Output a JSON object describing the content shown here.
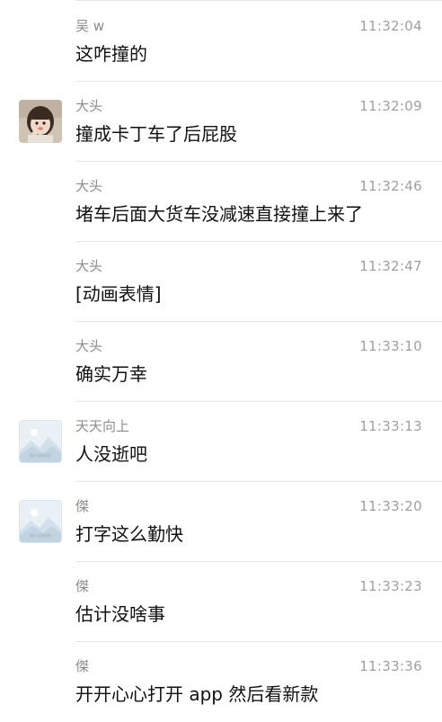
{
  "messages": [
    {
      "sender": "吴 w",
      "time": "11:32:04",
      "text": "这咋撞的",
      "avatar": "none"
    },
    {
      "sender": "大头",
      "time": "11:32:09",
      "text": "撞成卡丁车了后屁股",
      "avatar": "photo"
    },
    {
      "sender": "大头",
      "time": "11:32:46",
      "text": "堵车后面大货车没减速直接撞上来了",
      "avatar": "none"
    },
    {
      "sender": "大头",
      "time": "11:32:47",
      "text": "[动画表情]",
      "avatar": "none"
    },
    {
      "sender": "大头",
      "time": "11:33:10",
      "text": "确实万幸",
      "avatar": "none"
    },
    {
      "sender": "天天向上",
      "time": "11:33:13",
      "text": "人没逝吧",
      "avatar": "placeholder"
    },
    {
      "sender": "傑",
      "time": "11:33:20",
      "text": "打字这么勤快",
      "avatar": "placeholder"
    },
    {
      "sender": "傑",
      "time": "11:33:23",
      "text": "估计没啥事",
      "avatar": "none"
    },
    {
      "sender": "傑",
      "time": "11:33:36",
      "text": "开开心心打开 app 然后看新款",
      "avatar": "none"
    }
  ],
  "placeholder_caption": "图片加载失败",
  "colors": {
    "sender": "#8c8c8c",
    "time": "#a0a0a0",
    "text": "#111111",
    "divider": "#e6e6e6",
    "placeholder_bg": "#e9f0f6"
  },
  "icons": {
    "photo_avatar": "child-photo-avatar",
    "placeholder_avatar": "image-placeholder-icon"
  }
}
